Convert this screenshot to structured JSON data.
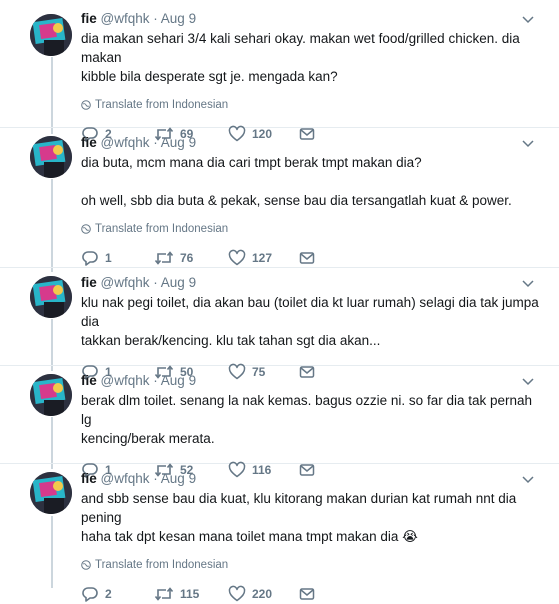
{
  "user": {
    "name": "fie",
    "handle": "@wfqhk"
  },
  "translate_label": "Translate from Indonesian",
  "tweets": [
    {
      "date": "Aug 9",
      "text": "dia makan sehari 3/4 kali sehari okay. makan wet food/grilled chicken. dia makan\nkibble bila desperate sgt je. mengada kan?",
      "replies": "2",
      "retweets": "69",
      "likes": "120"
    },
    {
      "date": "Aug 9",
      "text": "dia buta, mcm mana dia cari tmpt berak tmpt makan dia?\n\noh well, sbb dia buta & pekak, sense bau dia tersangatlah kuat & power.",
      "replies": "1",
      "retweets": "76",
      "likes": "127"
    },
    {
      "date": "Aug 9",
      "text": "klu nak pegi toilet, dia akan bau (toilet dia kt luar rumah) selagi dia tak jumpa dia\ntakkan berak/kencing. klu tak tahan sgt dia akan...",
      "replies": "1",
      "retweets": "50",
      "likes": "75"
    },
    {
      "date": "Aug 9",
      "text": "berak dlm toilet. senang la nak kemas. bagus ozzie ni. so far dia tak pernah lg\nkencing/berak merata.",
      "replies": "1",
      "retweets": "52",
      "likes": "116"
    },
    {
      "date": "Aug 9",
      "text": "and sbb sense bau dia kuat, klu kitorang makan durian kat rumah nnt dia pening\nhaha tak dpt kesan mana toilet mana tmpt makan dia 😭",
      "replies": "2",
      "retweets": "115",
      "likes": "220"
    }
  ],
  "colors": {
    "text": "#14171a",
    "secondary": "#657786",
    "border": "#e6ecf0",
    "thread_line": "#ccd6dd"
  },
  "icons": [
    "reply-icon",
    "retweet-icon",
    "like-icon",
    "message-icon",
    "globe-icon",
    "caret-down-icon"
  ]
}
